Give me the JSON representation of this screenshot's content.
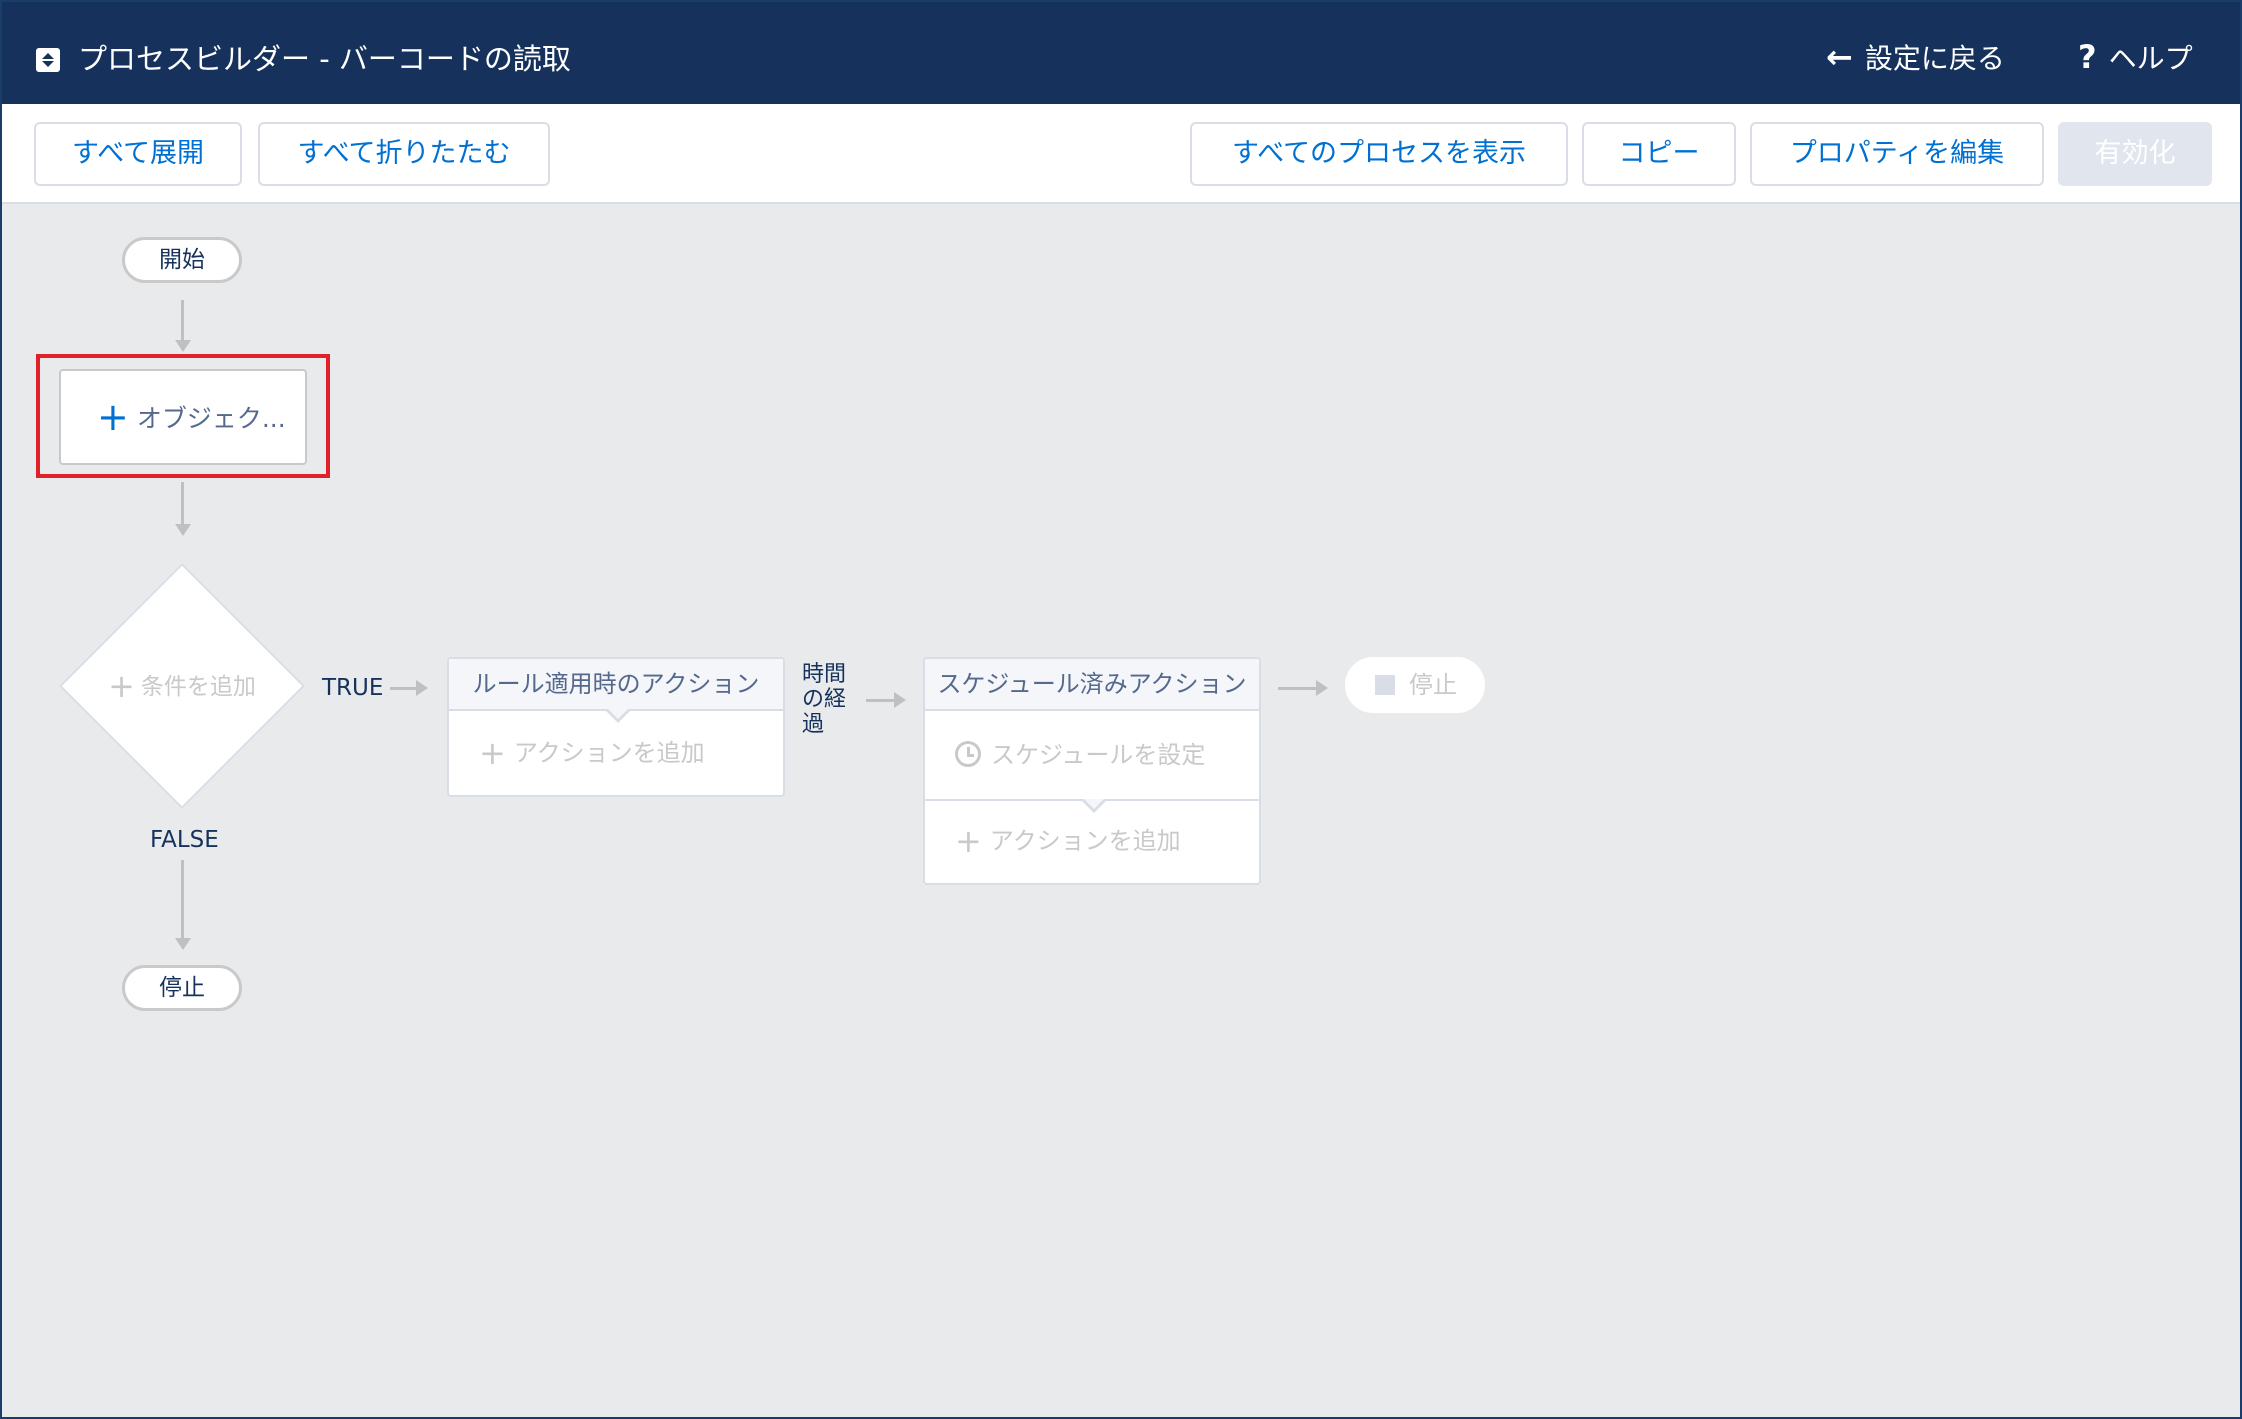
{
  "header": {
    "title": "プロセスビルダー - バーコードの読取",
    "back_label": "設定に戻る",
    "help_label": "ヘルプ",
    "back_icon": "arrow-left-icon",
    "help_icon": "question-icon"
  },
  "toolbar": {
    "expand_all": "すべて展開",
    "collapse_all": "すべて折りたたむ",
    "view_all_processes": "すべてのプロセスを表示",
    "copy": "コピー",
    "edit_properties": "プロパティを編集",
    "activate": "有効化"
  },
  "canvas": {
    "start": "開始",
    "object_node": "オブジェク...",
    "criteria_node": "条件を追加",
    "true_label": "TRUE",
    "false_label": "FALSE",
    "end_stop": "停止",
    "immediate_actions": {
      "title": "ルール適用時のアクション",
      "add_action": "アクションを追加"
    },
    "time_label": [
      "時間",
      "の経",
      "過"
    ],
    "scheduled_actions": {
      "title": "スケジュール済みアクション",
      "set_schedule": "スケジュールを設定",
      "add_action": "アクションを追加"
    },
    "stop_label": "停止"
  },
  "colors": {
    "header_bg": "#16325c",
    "accent": "#0070d2",
    "highlight": "#e0202a",
    "canvas_bg": "#e9eaec"
  }
}
